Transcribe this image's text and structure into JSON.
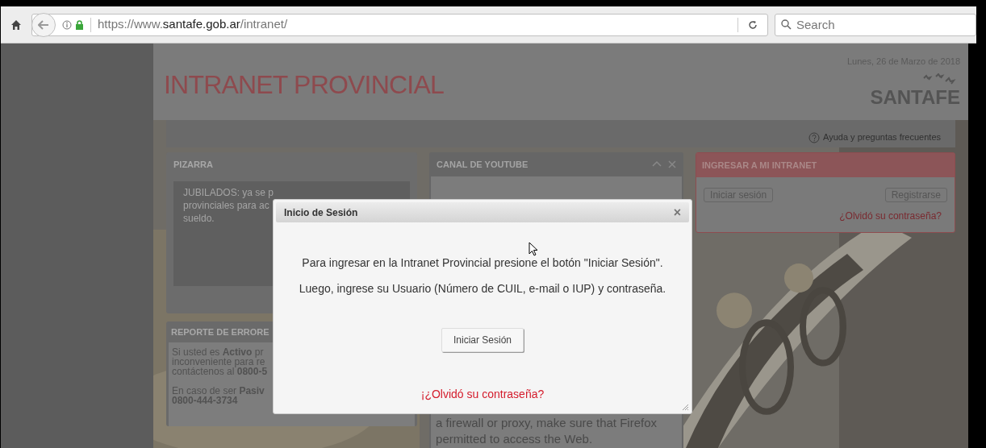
{
  "browser": {
    "url_prefix": "https://www.",
    "url_domain": "santafe.gob.ar",
    "url_path": "/intranet/",
    "search_placeholder": "Search"
  },
  "header": {
    "date": "Lunes, 26 de Marzo de 2018",
    "title": "INTRANET PROVINCIAL",
    "logo": "SANTAFE",
    "help_link": "Ayuda y preguntas frecuentes"
  },
  "pizarra": {
    "title": "PIZARRA",
    "lines": [
      "JUBILADOS: ya se p",
      "provinciales para ac",
      "sueldo."
    ]
  },
  "reporte": {
    "title": "REPORTE DE ERRORE",
    "lines": [
      "Si usted es **Activo** pr",
      "inconveniente para re",
      "contáctenos al **0800-5**"
    ],
    "lines2": [
      "En caso de ser **Pasiv**",
      "**0800-444-3734**"
    ]
  },
  "youtube": {
    "title": "CANAL DE YOUTUBE",
    "error_lines": [
      "a firewall or proxy, make sure that Firefox",
      "permitted to access the Web."
    ]
  },
  "login": {
    "title": "INGRESAR A MI INTRANET",
    "buttons": [
      "Iniciar sesión",
      "Registrarse"
    ],
    "forgot": "¿Olvidó su contraseña?"
  },
  "dialog": {
    "title": "Inicio de Sesión",
    "close": "×",
    "message": [
      "Para ingresar en la Intranet Provincial presione el botón \"Iniciar Sesión\".",
      "Luego, ingrese su Usuario (Número de CUIL, e-mail o IUP) y contraseña."
    ],
    "button": "Iniciar Sesión",
    "link": "¡¿Olvidó su contraseña?"
  }
}
